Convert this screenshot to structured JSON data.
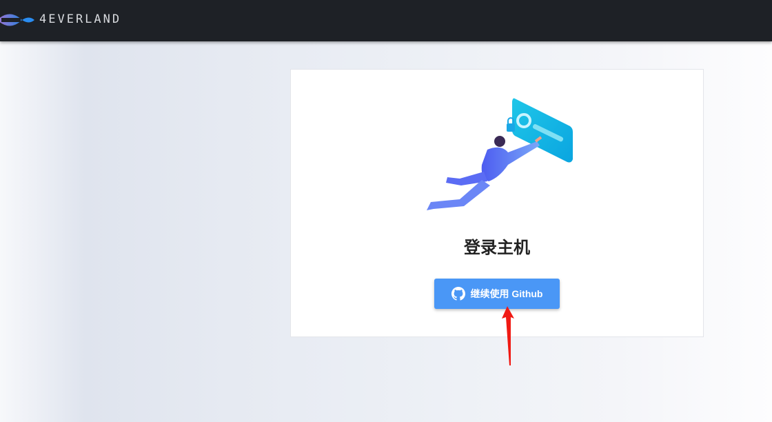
{
  "header": {
    "brand": "4EVERLAND"
  },
  "login": {
    "title": "登录主机",
    "button_label": "继续使用 Github"
  },
  "colors": {
    "accent": "#4a97f6",
    "header": "#1e2126"
  }
}
